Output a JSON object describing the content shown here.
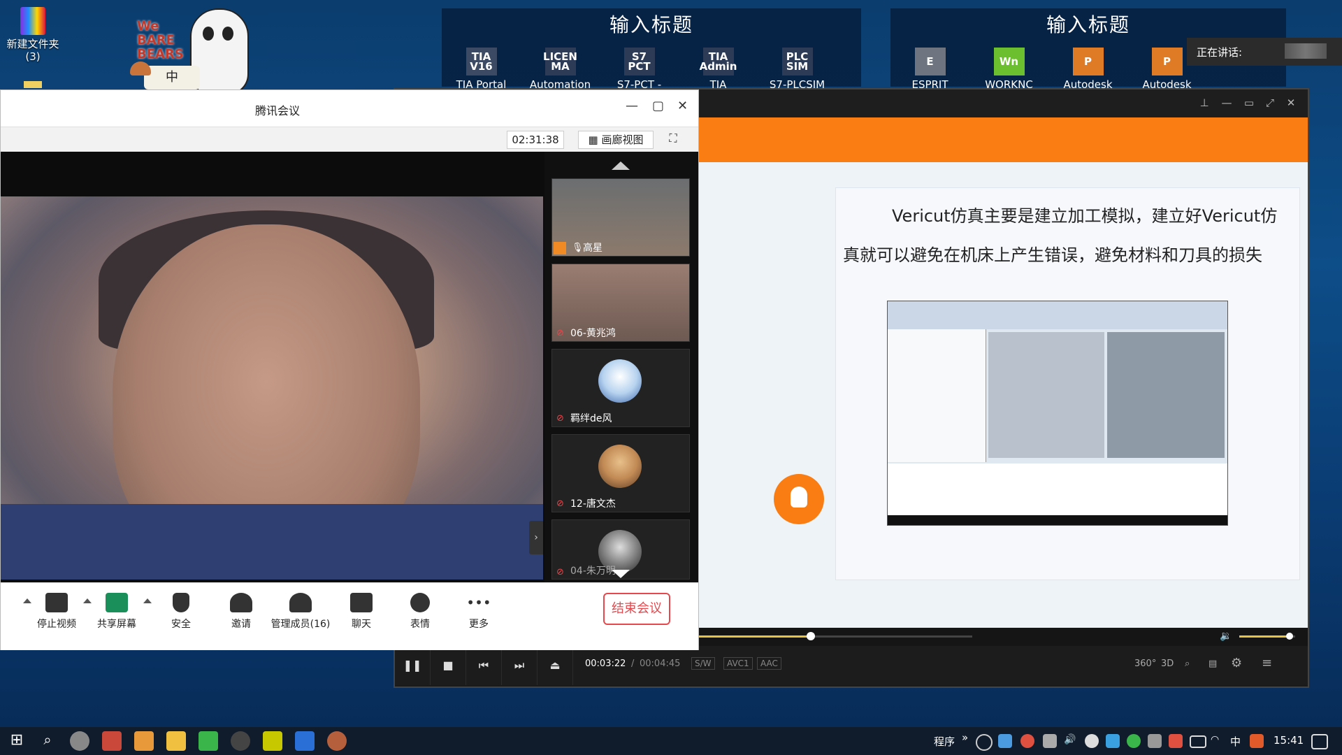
{
  "desktop": {
    "icons": [
      {
        "label": "新建文件夹\n(3)"
      }
    ],
    "sticker_text": "We BARE BEARS",
    "sticker_sub": "中"
  },
  "launchers": [
    {
      "title": "输入标题",
      "apps": [
        {
          "label": "TIA Portal",
          "glyph": "TIA\nV16",
          "color": "#3c4a63"
        },
        {
          "label": "Automation",
          "glyph": "LICEN\nMA",
          "color": "#2d3b57"
        },
        {
          "label": "S7-PCT -",
          "glyph": "S7\nPCT",
          "color": "#2d3b57"
        },
        {
          "label": "TIA",
          "glyph": "TIA\nAdmin",
          "color": "#2d3b57"
        },
        {
          "label": "S7-PLCSIM",
          "glyph": "PLC\nSIM",
          "color": "#2d3b57"
        }
      ]
    },
    {
      "title": "输入标题",
      "apps": [
        {
          "label": "ESPRIT",
          "glyph": "E",
          "color": "#6e7580"
        },
        {
          "label": "WORKNC",
          "glyph": "Wn",
          "color": "#6cbf2e"
        },
        {
          "label": "Autodesk",
          "glyph": "P",
          "color": "#e07b25"
        },
        {
          "label": "Autodesk",
          "glyph": "P",
          "color": "#e07b25"
        }
      ]
    }
  ],
  "speaking_label": "正在讲话:",
  "player": {
    "slide_text_line1": "Vericut仿真主要是建立加工模拟，建立好Vericut仿",
    "slide_text_line2": "真就可以避免在机床上产生错误，避免材料和刀具的损失",
    "current_time": "00:03:22",
    "separator": "/",
    "total_time": "00:04:45",
    "tags": [
      "S/W",
      "AVC1",
      "AAC"
    ],
    "progress": 0.72,
    "volume": 0.9,
    "right_icons": [
      "360°",
      "3D"
    ]
  },
  "meeting": {
    "title": "腾讯会议",
    "timer": "02:31:38",
    "gallery_view": "画廊视图",
    "participants": [
      {
        "name": "高星",
        "avatar_color": "#8a8a8a"
      },
      {
        "name": "06-黄兆鸿",
        "avatar_color": "#9a7d72"
      },
      {
        "name": "羁绊de风",
        "avatar_color": "#3a64a8"
      },
      {
        "name": "12-唐文杰",
        "avatar_color": "#c28a55"
      },
      {
        "name": "04-朱万明",
        "avatar_color": "#555555"
      }
    ],
    "toolbar": {
      "stop_video": "停止视频",
      "share_screen": "共享屏幕",
      "security": "安全",
      "invite": "邀请",
      "manage_members": "管理成员(16)",
      "chat": "聊天",
      "emoji": "表情",
      "more": "更多",
      "end_meeting": "结束会议"
    }
  },
  "taskbar": {
    "tray_label": "程序",
    "ime": "中",
    "clock": "15:41"
  }
}
